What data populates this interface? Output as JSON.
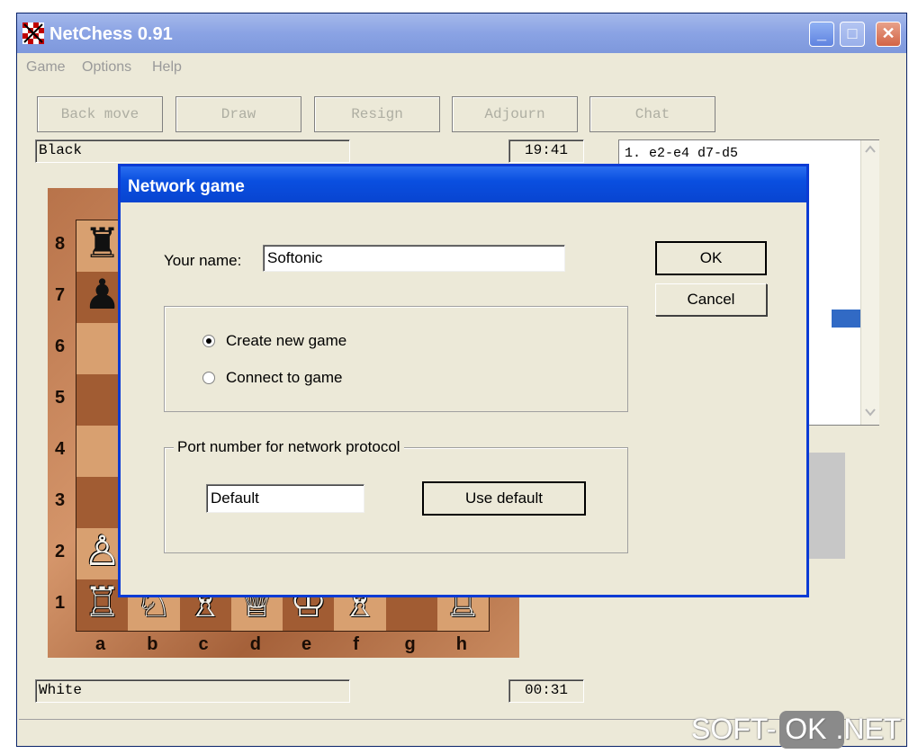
{
  "window": {
    "title": "NetChess 0.91",
    "minimize": "_",
    "maximize": "□",
    "close": "✕"
  },
  "menu": [
    "Game",
    "Options",
    "Help"
  ],
  "toolbar": [
    "Back move",
    "Draw",
    "Resign",
    "Adjourn",
    "Chat"
  ],
  "players": {
    "top": {
      "name": "Black",
      "clock": "19:41"
    },
    "bottom": {
      "name": "White",
      "clock": "00:31"
    }
  },
  "moves": {
    "line1": "1. e2-e4  d7-d5"
  },
  "board": {
    "files": [
      "a",
      "b",
      "c",
      "d",
      "e",
      "f",
      "g",
      "h"
    ],
    "ranks": [
      "8",
      "7",
      "6",
      "5",
      "4",
      "3",
      "2",
      "1"
    ],
    "pieces": {
      "a8": "♜",
      "a7": "♟",
      "a2": "♙",
      "a1": "♖",
      "b1": "♘",
      "c1": "♗",
      "d1": "♕",
      "e1": "♔",
      "f1": "♗",
      "h1": "♖"
    }
  },
  "dialog": {
    "title": "Network game",
    "name_label": "Your name:",
    "name_value": "Softonic",
    "ok": "OK",
    "cancel": "Cancel",
    "mode_options": [
      {
        "label": "Create new game",
        "selected": true
      },
      {
        "label": "Connect to game",
        "selected": false
      }
    ],
    "port_group_label": "Port number for network protocol",
    "port_value": "Default",
    "use_default": "Use default"
  },
  "watermark": {
    "text_left": "SOFT-",
    "text_box": "OK",
    "text_right": ".NET"
  }
}
